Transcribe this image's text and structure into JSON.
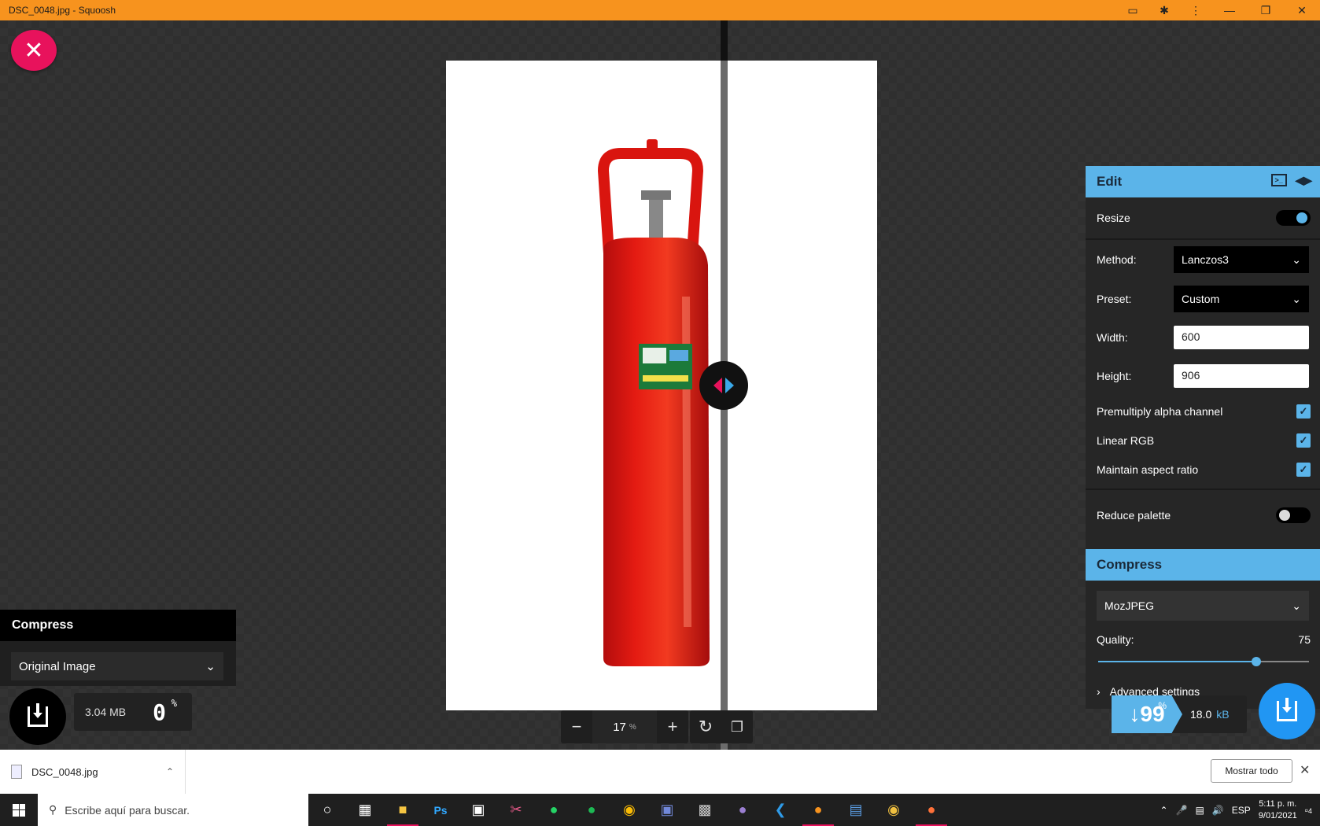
{
  "window": {
    "title": "DSC_0048.jpg - Squoosh"
  },
  "left": {
    "compress_title": "Compress",
    "codec": "Original Image",
    "size": "3.04 MB",
    "percent": "0",
    "percent_unit": "%"
  },
  "zoom": {
    "value": "17",
    "unit": "%"
  },
  "edit": {
    "title": "Edit",
    "resize_label": "Resize",
    "resize_enabled": true,
    "method_label": "Method:",
    "method_value": "Lanczos3",
    "preset_label": "Preset:",
    "preset_value": "Custom",
    "width_label": "Width:",
    "width_value": "600",
    "height_label": "Height:",
    "height_value": "906",
    "premultiply_label": "Premultiply alpha channel",
    "linear_rgb_label": "Linear RGB",
    "aspect_label": "Maintain aspect ratio",
    "reduce_palette_label": "Reduce palette",
    "reduce_palette_enabled": false
  },
  "compress": {
    "title": "Compress",
    "codec": "MozJPEG",
    "quality_label": "Quality:",
    "quality_value": "75",
    "quality_fraction": 0.75,
    "advanced_label": "Advanced settings",
    "result_percent": "↓99",
    "result_percent_unit": "%",
    "result_size": "18.0",
    "result_unit": "kB"
  },
  "downloads": {
    "file_name": "DSC_0048.jpg",
    "show_all": "Mostrar todo"
  },
  "taskbar": {
    "search_placeholder": "Escribe aquí para buscar.",
    "lang": "ESP",
    "time": "5:11 p. m.",
    "date": "9/01/2021",
    "notifications": "4"
  },
  "colors": {
    "accent_pink": "#e8125c",
    "accent_blue": "#5bb4e9",
    "titlebar": "#f7931e"
  }
}
